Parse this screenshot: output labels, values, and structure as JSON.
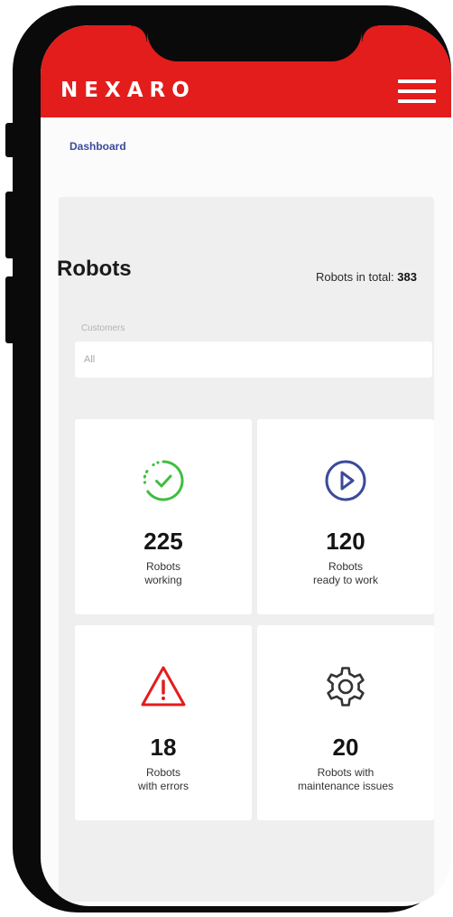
{
  "app": {
    "brand": "NEXARO",
    "accent_color": "#e31c1c"
  },
  "breadcrumb": {
    "current": "Dashboard"
  },
  "robots": {
    "title": "Robots",
    "total_label": "Robots in total:",
    "total_value": "383"
  },
  "filter": {
    "label": "Customers",
    "value": "All"
  },
  "stats": [
    {
      "value": "225",
      "label_line1": "Robots",
      "label_line2": "working",
      "icon": "check-circle-icon",
      "color": "#3fbf3f"
    },
    {
      "value": "120",
      "label_line1": "Robots",
      "label_line2": "ready to work",
      "icon": "play-circle-icon",
      "color": "#3b4b9a"
    },
    {
      "value": "18",
      "label_line1": "Robots",
      "label_line2": "with errors",
      "icon": "warning-triangle-icon",
      "color": "#e31c1c"
    },
    {
      "value": "20",
      "label_line1": "Robots with",
      "label_line2": "maintenance issues",
      "icon": "gear-icon",
      "color": "#333333"
    }
  ]
}
